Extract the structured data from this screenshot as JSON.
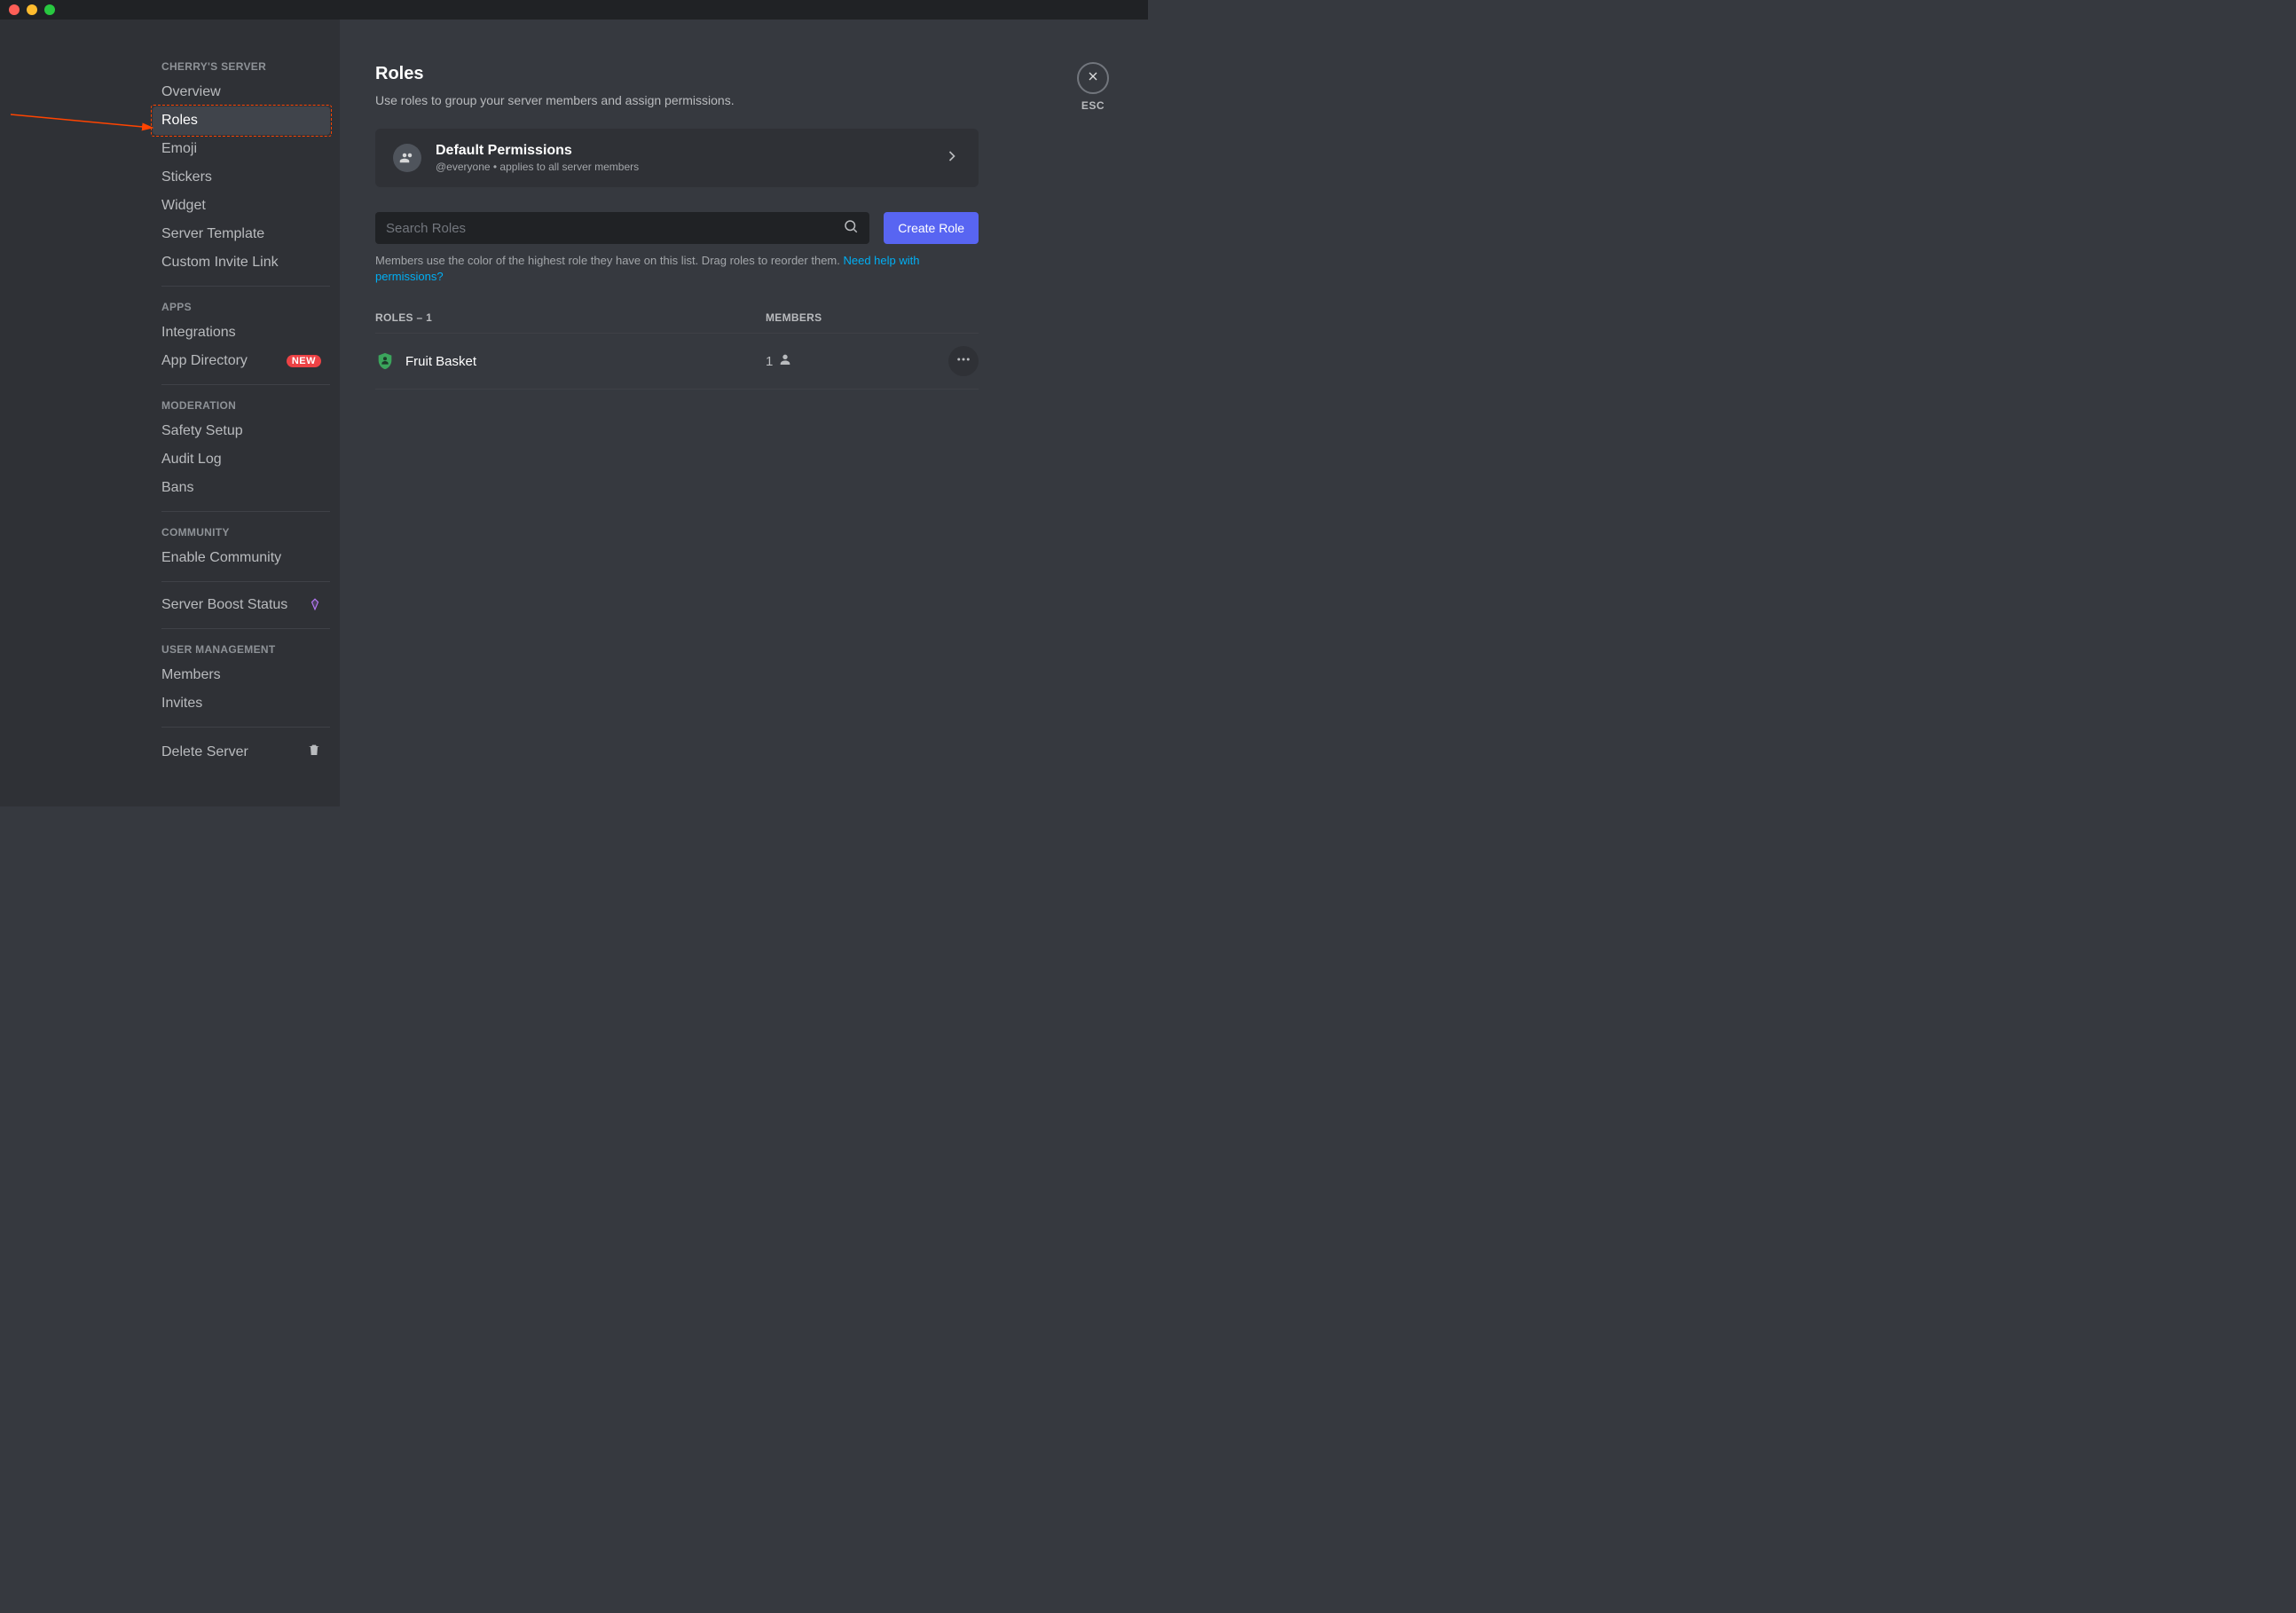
{
  "sidebar": {
    "server_name_header": "CHERRY'S SERVER",
    "items_server": [
      {
        "label": "Overview"
      },
      {
        "label": "Roles"
      },
      {
        "label": "Emoji"
      },
      {
        "label": "Stickers"
      },
      {
        "label": "Widget"
      },
      {
        "label": "Server Template"
      },
      {
        "label": "Custom Invite Link"
      }
    ],
    "apps_header": "APPS",
    "items_apps": [
      {
        "label": "Integrations"
      },
      {
        "label": "App Directory",
        "badge": "NEW"
      }
    ],
    "moderation_header": "MODERATION",
    "items_moderation": [
      {
        "label": "Safety Setup"
      },
      {
        "label": "Audit Log"
      },
      {
        "label": "Bans"
      }
    ],
    "community_header": "COMMUNITY",
    "items_community": [
      {
        "label": "Enable Community"
      }
    ],
    "boost_label": "Server Boost Status",
    "user_mgmt_header": "USER MANAGEMENT",
    "items_user_mgmt": [
      {
        "label": "Members"
      },
      {
        "label": "Invites"
      }
    ],
    "delete_label": "Delete Server"
  },
  "main": {
    "title": "Roles",
    "subtitle": "Use roles to group your server members and assign permissions.",
    "default_perm_title": "Default Permissions",
    "default_perm_sub": "@everyone • applies to all server members",
    "search_placeholder": "Search Roles",
    "create_role_label": "Create Role",
    "helper_text": "Members use the color of the highest role they have on this list. Drag roles to reorder them. ",
    "helper_link": "Need help with permissions?",
    "roles_header": "ROLES – 1",
    "members_header": "MEMBERS",
    "roles": [
      {
        "name": "Fruit Basket",
        "members": "1",
        "color": "#3ba55c"
      }
    ]
  },
  "close": {
    "esc_label": "ESC"
  }
}
